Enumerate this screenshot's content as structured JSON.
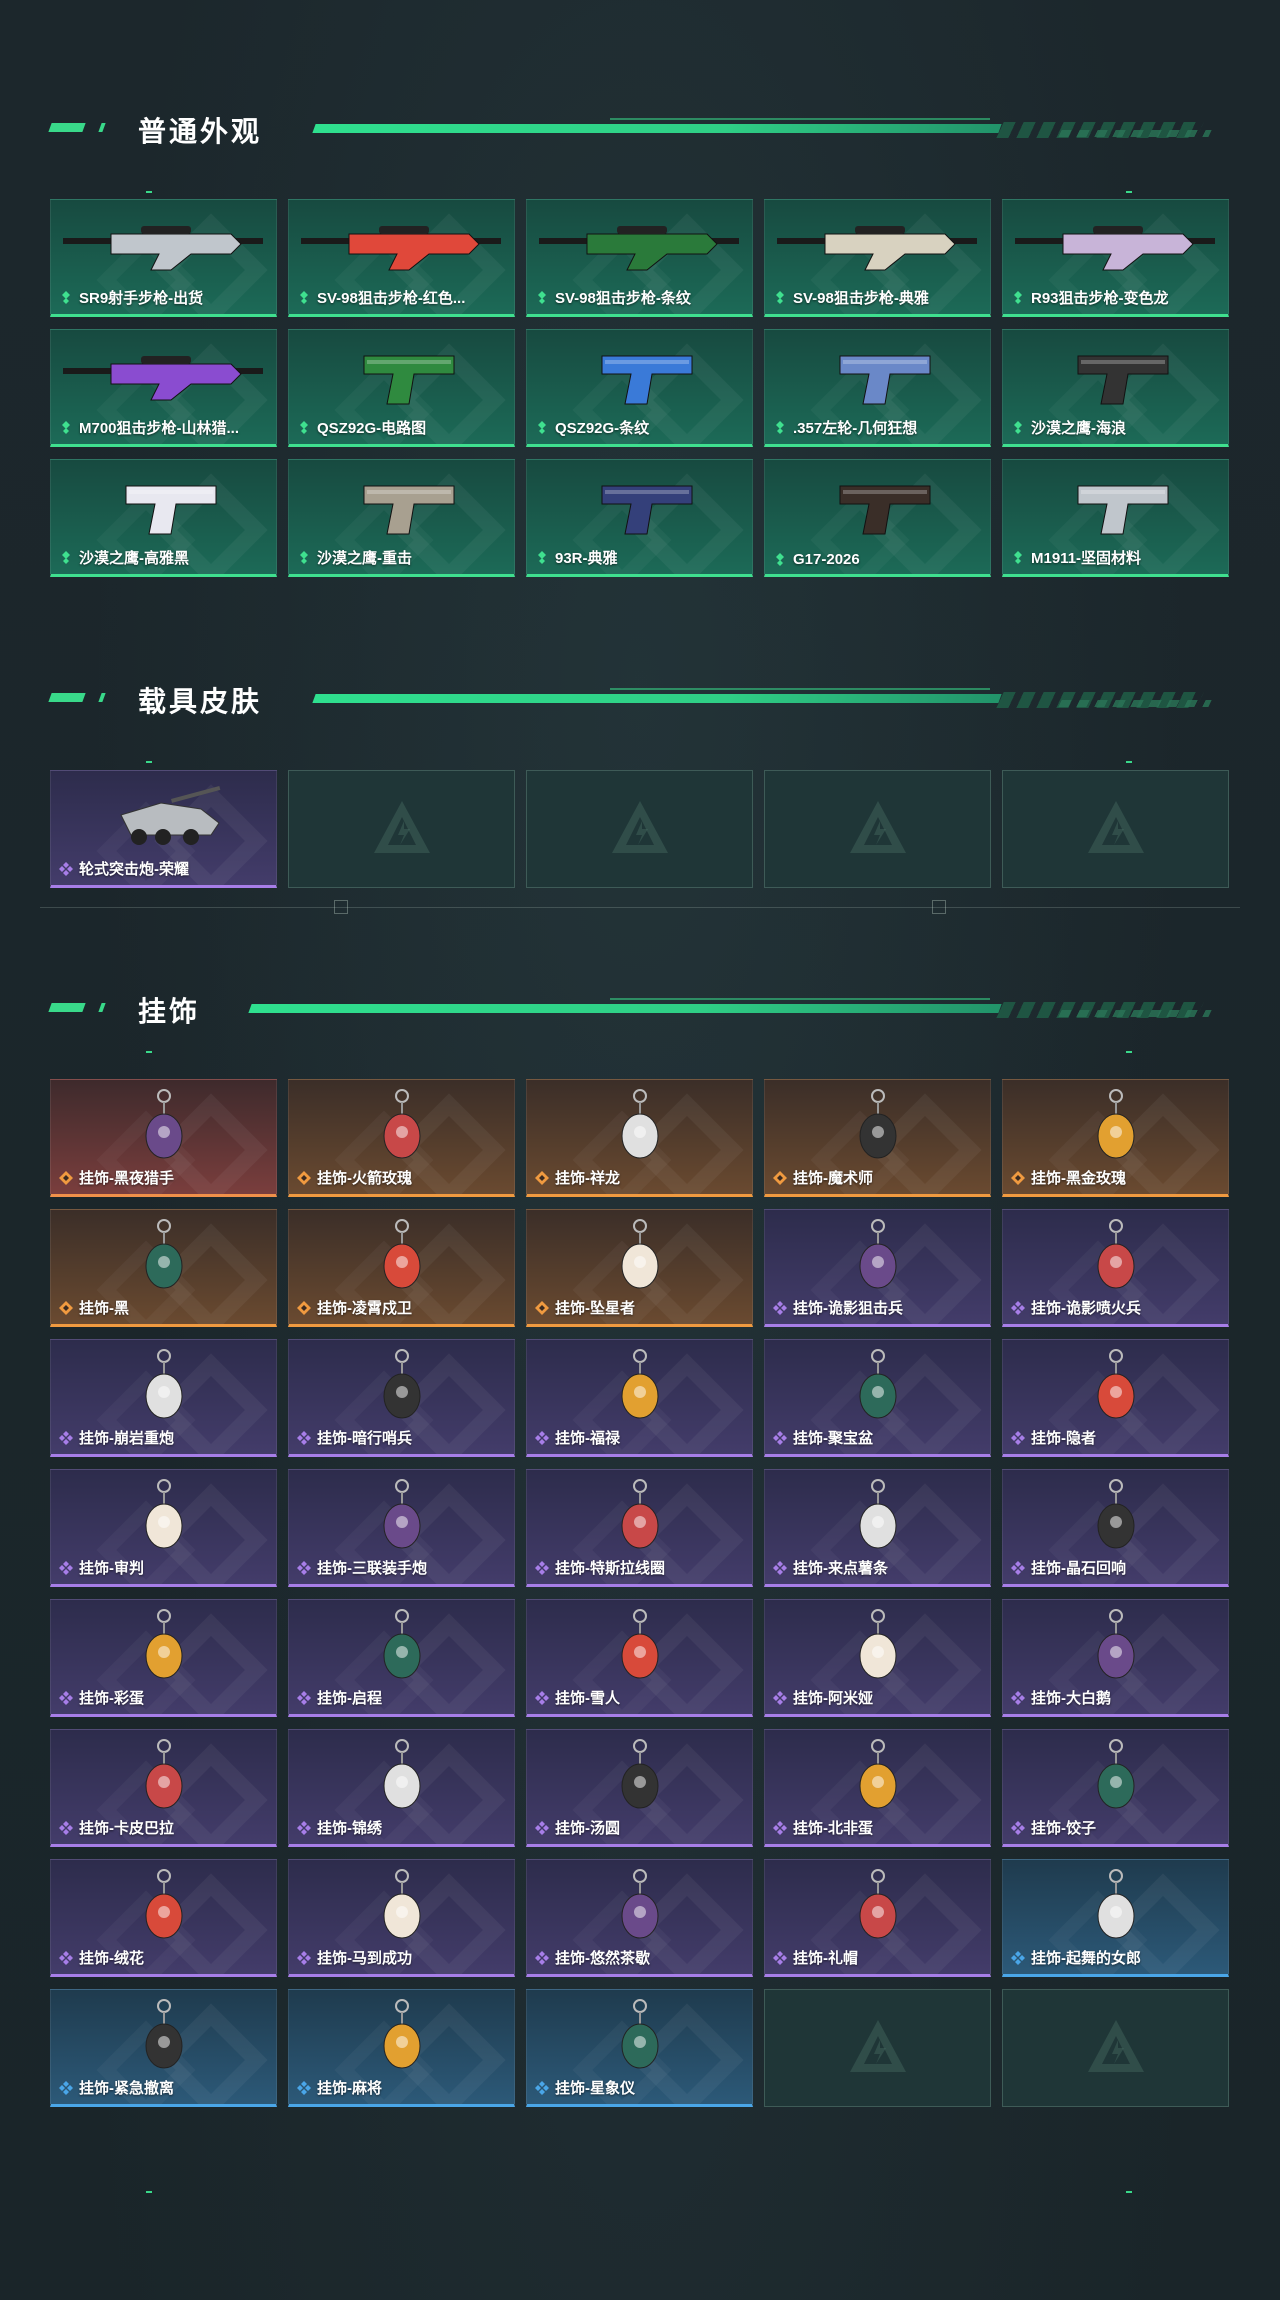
{
  "colors": {
    "accent": "#39d98a",
    "rarity_green": "#3fe08f",
    "rarity_purple": "#a77ee8",
    "rarity_orange": "#f09a40",
    "rarity_blue": "#4aa6e8"
  },
  "sections": [
    {
      "title": "普通外观",
      "items": [
        {
          "name": "SR9射手步枪-出货",
          "rarity": "green",
          "icon": "rifle-icon"
        },
        {
          "name": "SV-98狙击步枪-红色...",
          "rarity": "green",
          "icon": "sniper-rifle-icon"
        },
        {
          "name": "SV-98狙击步枪-条纹",
          "rarity": "green",
          "icon": "sniper-rifle-icon"
        },
        {
          "name": "SV-98狙击步枪-典雅",
          "rarity": "green",
          "icon": "sniper-rifle-icon"
        },
        {
          "name": "R93狙击步枪-变色龙",
          "rarity": "green",
          "icon": "sniper-rifle-icon"
        },
        {
          "name": "M700狙击步枪-山林猎...",
          "rarity": "green",
          "icon": "sniper-rifle-icon"
        },
        {
          "name": "QSZ92G-电路图",
          "rarity": "green",
          "icon": "pistol-icon"
        },
        {
          "name": "QSZ92G-条纹",
          "rarity": "green",
          "icon": "pistol-icon"
        },
        {
          "name": ".357左轮-几何狂想",
          "rarity": "green",
          "icon": "revolver-icon"
        },
        {
          "name": "沙漠之鹰-海浪",
          "rarity": "green",
          "icon": "pistol-icon"
        },
        {
          "name": "沙漠之鹰-高雅黑",
          "rarity": "green",
          "icon": "pistol-icon"
        },
        {
          "name": "沙漠之鹰-重击",
          "rarity": "green",
          "icon": "pistol-icon"
        },
        {
          "name": "93R-典雅",
          "rarity": "green",
          "icon": "pistol-icon"
        },
        {
          "name": "G17-2026",
          "rarity": "green",
          "icon": "pistol-icon"
        },
        {
          "name": "M1911-坚固材料",
          "rarity": "green",
          "icon": "pistol-icon"
        }
      ]
    },
    {
      "title": "载具皮肤",
      "items": [
        {
          "name": "轮式突击炮-荣耀",
          "rarity": "purple",
          "icon": "vehicle-icon"
        },
        {
          "name": "",
          "rarity": "empty",
          "icon": "placeholder-logo-icon"
        },
        {
          "name": "",
          "rarity": "empty",
          "icon": "placeholder-logo-icon"
        },
        {
          "name": "",
          "rarity": "empty",
          "icon": "placeholder-logo-icon"
        },
        {
          "name": "",
          "rarity": "empty",
          "icon": "placeholder-logo-icon"
        }
      ]
    },
    {
      "title": "挂饰",
      "items": [
        {
          "name": "挂饰-黑夜猎手",
          "rarity": "red",
          "icon": "charm-icon"
        },
        {
          "name": "挂饰-火箭玫瑰",
          "rarity": "orange",
          "icon": "charm-icon"
        },
        {
          "name": "挂饰-祥龙",
          "rarity": "orange",
          "icon": "charm-icon"
        },
        {
          "name": "挂饰-魔术师",
          "rarity": "orange",
          "icon": "charm-icon"
        },
        {
          "name": "挂饰-黑金玫瑰",
          "rarity": "orange",
          "icon": "charm-icon"
        },
        {
          "name": "挂饰-黑",
          "rarity": "orange",
          "icon": "charm-icon"
        },
        {
          "name": "挂饰-凌霄戍卫",
          "rarity": "orange",
          "icon": "charm-icon"
        },
        {
          "name": "挂饰-坠星者",
          "rarity": "orange",
          "icon": "charm-icon"
        },
        {
          "name": "挂饰-诡影狙击兵",
          "rarity": "purple",
          "icon": "charm-icon"
        },
        {
          "name": "挂饰-诡影喷火兵",
          "rarity": "purple",
          "icon": "charm-icon"
        },
        {
          "name": "挂饰-崩岩重炮",
          "rarity": "purple",
          "icon": "charm-icon"
        },
        {
          "name": "挂饰-暗行哨兵",
          "rarity": "purple",
          "icon": "charm-icon"
        },
        {
          "name": "挂饰-福禄",
          "rarity": "purple",
          "icon": "charm-icon"
        },
        {
          "name": "挂饰-聚宝盆",
          "rarity": "purple",
          "icon": "charm-icon"
        },
        {
          "name": "挂饰-隐者",
          "rarity": "purple",
          "icon": "charm-icon"
        },
        {
          "name": "挂饰-审判",
          "rarity": "purple",
          "icon": "charm-icon"
        },
        {
          "name": "挂饰-三联装手炮",
          "rarity": "purple",
          "icon": "charm-icon"
        },
        {
          "name": "挂饰-特斯拉线圈",
          "rarity": "purple",
          "icon": "charm-icon"
        },
        {
          "name": "挂饰-来点薯条",
          "rarity": "purple",
          "icon": "charm-icon"
        },
        {
          "name": "挂饰-晶石回响",
          "rarity": "purple",
          "icon": "charm-icon"
        },
        {
          "name": "挂饰-彩蛋",
          "rarity": "purple",
          "icon": "charm-icon"
        },
        {
          "name": "挂饰-启程",
          "rarity": "purple",
          "icon": "charm-icon"
        },
        {
          "name": "挂饰-雪人",
          "rarity": "purple",
          "icon": "charm-icon"
        },
        {
          "name": "挂饰-阿米娅",
          "rarity": "purple",
          "icon": "charm-icon"
        },
        {
          "name": "挂饰-大白鹅",
          "rarity": "purple",
          "icon": "charm-icon"
        },
        {
          "name": "挂饰-卡皮巴拉",
          "rarity": "purple",
          "icon": "charm-icon"
        },
        {
          "name": "挂饰-锦绣",
          "rarity": "purple",
          "icon": "charm-icon"
        },
        {
          "name": "挂饰-汤圆",
          "rarity": "purple",
          "icon": "charm-icon"
        },
        {
          "name": "挂饰-北非蛋",
          "rarity": "purple",
          "icon": "charm-icon"
        },
        {
          "name": "挂饰-饺子",
          "rarity": "purple",
          "icon": "charm-icon"
        },
        {
          "name": "挂饰-绒花",
          "rarity": "purple",
          "icon": "charm-icon"
        },
        {
          "name": "挂饰-马到成功",
          "rarity": "purple",
          "icon": "charm-icon"
        },
        {
          "name": "挂饰-悠然茶歇",
          "rarity": "purple",
          "icon": "charm-icon"
        },
        {
          "name": "挂饰-礼帽",
          "rarity": "purple",
          "icon": "charm-icon"
        },
        {
          "name": "挂饰-起舞的女郎",
          "rarity": "blue",
          "icon": "charm-icon"
        },
        {
          "name": "挂饰-紧急撤离",
          "rarity": "blue",
          "icon": "charm-icon"
        },
        {
          "name": "挂饰-麻将",
          "rarity": "blue",
          "icon": "charm-icon"
        },
        {
          "name": "挂饰-星象仪",
          "rarity": "blue",
          "icon": "charm-icon"
        },
        {
          "name": "",
          "rarity": "empty",
          "icon": "placeholder-logo-icon"
        },
        {
          "name": "",
          "rarity": "empty",
          "icon": "placeholder-logo-icon"
        }
      ]
    }
  ]
}
